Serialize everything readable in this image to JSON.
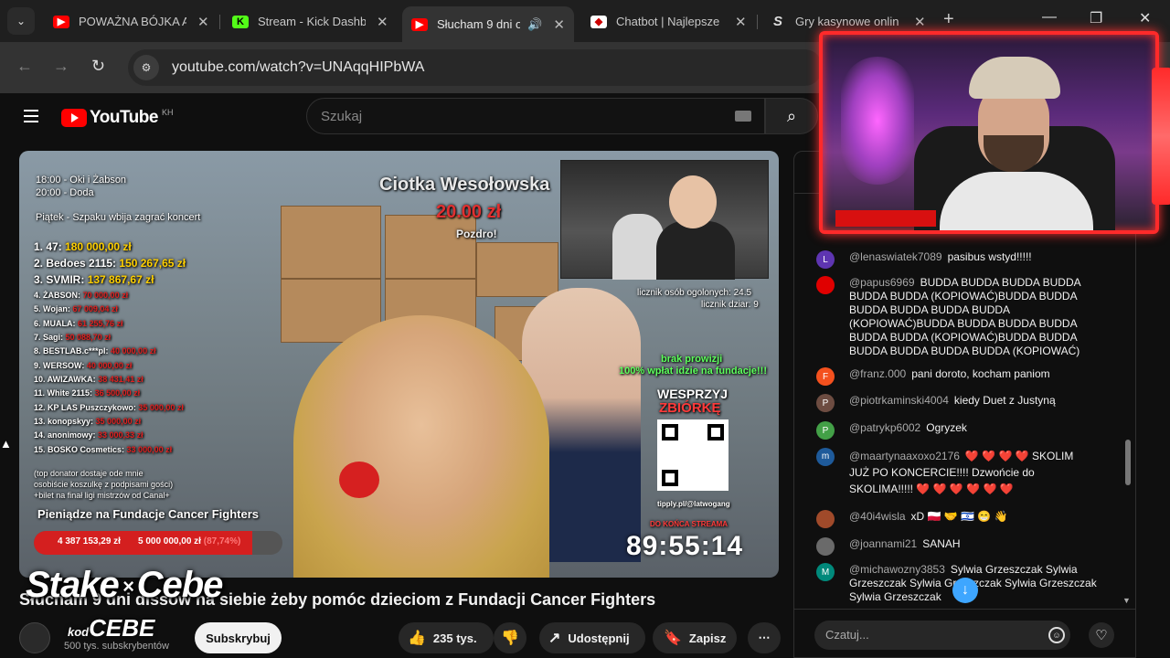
{
  "tabs": [
    {
      "title": "POWAŻNA BÓJKA A",
      "icon": "youtube-icon",
      "active": false
    },
    {
      "title": "Stream - Kick Dashb",
      "icon": "kick-icon",
      "active": false
    },
    {
      "title": "Słucham 9 dni o",
      "icon": "youtube-icon",
      "active": true
    },
    {
      "title": "Chatbot | Najlepsze",
      "icon": "chatbot-icon",
      "active": false
    },
    {
      "title": "Gry kasynowe onlin",
      "icon": "stake-icon",
      "active": false
    }
  ],
  "tab_close": "✕",
  "tab_new": "+",
  "window": {
    "minimize": "—",
    "maximize": "❐",
    "close": "✕"
  },
  "address": {
    "url": "youtube.com/watch?v=UNAqqHIPbWA"
  },
  "youtube": {
    "logo": "YouTube",
    "country": "KH",
    "search_placeholder": "Szukaj"
  },
  "video": {
    "schedule": [
      "18:00 - Oki i Żabson",
      "20:00 - Doda",
      "Piątek - Szpaku wbija zagrać koncert"
    ],
    "donor_name": "Ciotka Wesołowska",
    "donor_amount": "20.00 zł",
    "donor_msg": "Pozdro!",
    "leaderboard": [
      {
        "rank": "1. 47:",
        "amount": "180 000,00 zł"
      },
      {
        "rank": "2. Bedoes 2115:",
        "amount": "150 267,65 zł"
      },
      {
        "rank": "3. SVMIR:",
        "amount": "137 867,67 zł"
      },
      {
        "rank": "4. ŻABSON:",
        "amount": "70 000,00 zł"
      },
      {
        "rank": "5. Wojan:",
        "amount": "67 009,04 zł"
      },
      {
        "rank": "6. MUALA:",
        "amount": "61 255,76 zł"
      },
      {
        "rank": "7. Sagi:",
        "amount": "50 088,70 zł"
      },
      {
        "rank": "8. BESTLAB.c***pl:",
        "amount": "40 000,00 zł"
      },
      {
        "rank": "9. WERSOW:",
        "amount": "40 000,00 zł"
      },
      {
        "rank": "10. AWIZAWKA:",
        "amount": "38 431,41 zł"
      },
      {
        "rank": "11. White 2115:",
        "amount": "36 500,00 zł"
      },
      {
        "rank": "12. KP LAS Puszczykowo:",
        "amount": "35 000,00 zł"
      },
      {
        "rank": "13. konopskyy:",
        "amount": "35 000,00 zł"
      },
      {
        "rank": "14. anonimowy:",
        "amount": "33 000,33 zł"
      },
      {
        "rank": "15. BOSKO Cosmetics:",
        "amount": "33 000,00 zł"
      }
    ],
    "top_donator_note_1": "(top donator dostaje ode mnie",
    "top_donator_note_2": "osobiście koszulkę z podpisami gości)",
    "top_donator_note_3": "+bilet na finał ligi mistrzów od Canal+",
    "fund_title": "Pieniądze na Fundacje Cancer Fighters",
    "fund_raised": "4 387 153,29 zł",
    "fund_goal": "5 000 000,00 zł",
    "fund_percent_label": "(87,74%)",
    "fund_fraction": 0.8774,
    "counter_people": "licznik osób ogolonych: 24.5",
    "counter_dziar": "licznik dziar: 9",
    "no_fee_1": "brak prowizji",
    "no_fee_2": "100% wpłat idzie na fundacje!!!",
    "support_1": "WESPRZYJ",
    "support_2": "ZBIÓRKĘ",
    "tipply": "tipply.pl/@latwogang",
    "until_end": "DO KOŃCA STREAMA",
    "timer": "89:55:14"
  },
  "meta": {
    "title": "Słucham 9 dni dissów na siebie żeby pomóc dzieciom z Fundacji Cancer Fighters",
    "subscribers": "500 tys. subskrybentów",
    "subscribe_label": "Subskrybuj",
    "likes": "235 tys.",
    "share_label": "Udostępnij",
    "save_label": "Zapisz",
    "more": "⋯"
  },
  "overlay": {
    "brand_1": "Stake",
    "brand_x": "×",
    "brand_2": "Cebe",
    "code_prefix": "kod",
    "code": "CEBE"
  },
  "chat": {
    "messages": [
      {
        "avatar": "L",
        "color": "#5e35b1",
        "author": "@lenaswiatek7089",
        "text": "pasibus wstyd!!!!!"
      },
      {
        "avatar": "",
        "color": "#e00000",
        "author": "@papus6969",
        "text": "BUDDA BUDDA BUDDA BUDDA BUDDA BUDDA (KOPIOWAĆ)BUDDA BUDDA BUDDA BUDDA BUDDA BUDDA (KOPIOWAĆ)BUDDA BUDDA BUDDA BUDDA BUDDA BUDDA (KOPIOWAĆ)BUDDA BUDDA BUDDA BUDDA BUDDA BUDDA (KOPIOWAĆ)"
      },
      {
        "avatar": "F",
        "color": "#f4511e",
        "author": "@franz.000",
        "text": "pani doroto, kocham paniom"
      },
      {
        "avatar": "P",
        "color": "#6d4c41",
        "author": "@piotrkaminski4004",
        "text": "kiedy Duet z Justyną"
      },
      {
        "avatar": "P",
        "color": "#43a047",
        "author": "@patrykp6002",
        "text": "Ogryzek"
      },
      {
        "avatar": "m",
        "color": "#1e5a9a",
        "author": "@maartynaaxoxo2176",
        "text": "❤️ ❤️ ❤️ ❤️ SKOLIM JUŻ PO KONCERCIE!!!! Dzwońcie do SKOLIMA!!!!! ❤️ ❤️ ❤️ ❤️ ❤️ ❤️"
      },
      {
        "avatar": "",
        "color": "#a04a2a",
        "author": "@40i4wisla",
        "text": "xD 🇵🇱 🤝 🇮🇱 😁 👋"
      },
      {
        "avatar": "",
        "color": "#6a6a6a",
        "author": "@joannami21",
        "text": "SANAH"
      },
      {
        "avatar": "M",
        "color": "#00897b",
        "author": "@michawozny3853",
        "text": "Sylwia Grzeszczak Sylwia Grzeszczak Sylwia Grzeszczak Sylwia Grzeszczak Sylwia Grzeszczak"
      }
    ],
    "input_placeholder": "Czatuj..."
  },
  "colors": {
    "accent": "#ff0000",
    "fund_bar": "#d41f1f",
    "donation_gold": "#ffd000",
    "chat_link": "#3ea6ff"
  }
}
